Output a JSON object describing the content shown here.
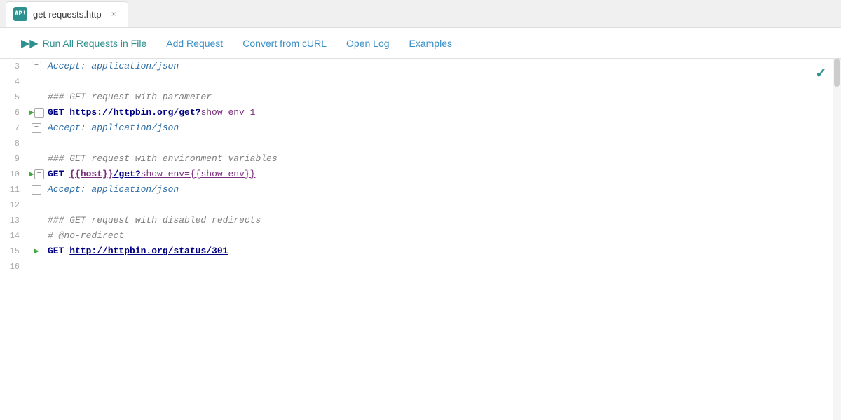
{
  "tab": {
    "icon_text": "AP!",
    "filename": "get-requests.http",
    "close_label": "×"
  },
  "toolbar": {
    "run_all_label": "Run All Requests in File",
    "add_request_label": "Add Request",
    "convert_curl_label": "Convert from cURL",
    "open_log_label": "Open Log",
    "examples_label": "Examples"
  },
  "lines": [
    {
      "num": "3",
      "gutter": "fold",
      "content_parts": [
        {
          "text": "Accept: application/json",
          "class": "c-header-key-val"
        }
      ]
    },
    {
      "num": "4",
      "gutter": "",
      "content_parts": []
    },
    {
      "num": "5",
      "gutter": "",
      "content_parts": [
        {
          "text": "### GET request with parameter",
          "class": "c-comment"
        }
      ]
    },
    {
      "num": "6",
      "gutter": "run-fold",
      "content_parts": [
        {
          "text": "GET ",
          "class": "c-method"
        },
        {
          "text": "https://httpbin.org/get?",
          "class": "c-url-link"
        },
        {
          "text": "show_env=1",
          "class": "c-query"
        }
      ]
    },
    {
      "num": "7",
      "gutter": "fold",
      "content_parts": [
        {
          "text": "Accept: application/json",
          "class": "c-header-key-val"
        }
      ]
    },
    {
      "num": "8",
      "gutter": "",
      "content_parts": []
    },
    {
      "num": "9",
      "gutter": "",
      "content_parts": [
        {
          "text": "### GET request with environment variables",
          "class": "c-comment"
        }
      ]
    },
    {
      "num": "10",
      "gutter": "run-fold",
      "content_parts": [
        {
          "text": "GET ",
          "class": "c-method"
        },
        {
          "text": "{{host}}",
          "class": "c-env-var"
        },
        {
          "text": "/get?",
          "class": "c-url-link"
        },
        {
          "text": "show_env={{show_env}}",
          "class": "c-query"
        }
      ]
    },
    {
      "num": "11",
      "gutter": "fold",
      "content_parts": [
        {
          "text": "Accept: application/json",
          "class": "c-header-key-val"
        }
      ]
    },
    {
      "num": "12",
      "gutter": "",
      "content_parts": []
    },
    {
      "num": "13",
      "gutter": "",
      "content_parts": [
        {
          "text": "### GET request with disabled redirects",
          "class": "c-comment"
        }
      ]
    },
    {
      "num": "14",
      "gutter": "",
      "content_parts": [
        {
          "text": "# @no-redirect",
          "class": "c-comment"
        }
      ]
    },
    {
      "num": "15",
      "gutter": "run",
      "content_parts": [
        {
          "text": "GET ",
          "class": "c-method"
        },
        {
          "text": "http://httpbin.org/status/301",
          "class": "c-url-link"
        }
      ]
    },
    {
      "num": "16",
      "gutter": "",
      "content_parts": []
    }
  ]
}
